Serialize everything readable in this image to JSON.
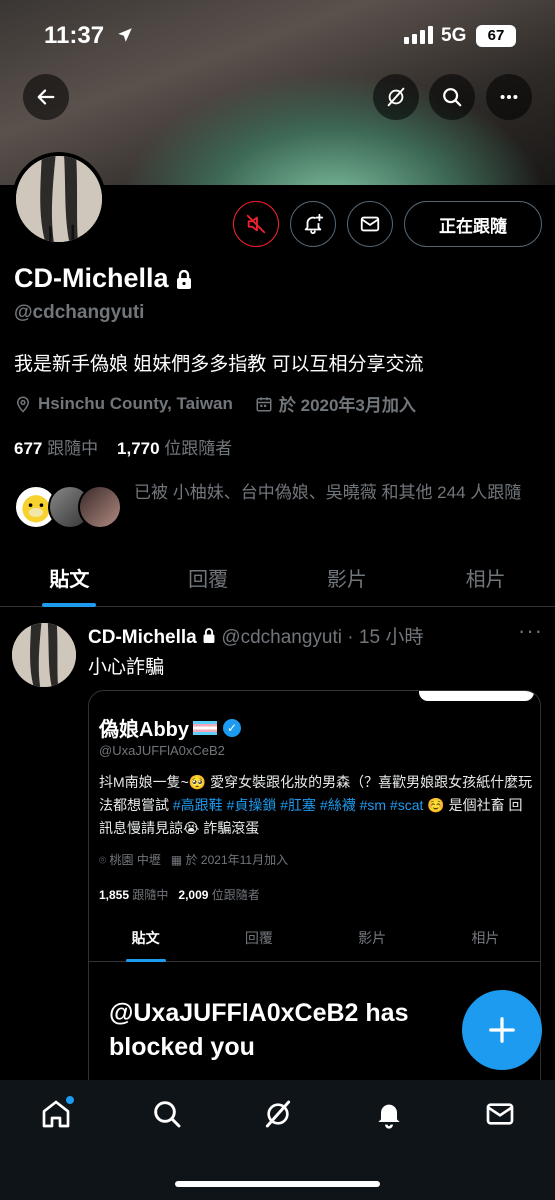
{
  "status": {
    "time": "11:37",
    "network": "5G",
    "battery": "67"
  },
  "profile": {
    "name": "CD-Michella",
    "handle": "@cdchangyuti",
    "bio": "我是新手偽娘 姐妹們多多指教 可以互相分享交流",
    "location": "Hsinchu County, Taiwan",
    "joined": "於 2020年3月加入",
    "following_count": "677",
    "following_label": "跟隨中",
    "followers_count": "1,770",
    "followers_label": "位跟隨者",
    "followed_by": "已被 小柚妹、台中偽娘、吳曉薇 和其他 244 人跟隨",
    "follow_button": "正在跟隨"
  },
  "tabs": [
    "貼文",
    "回覆",
    "影片",
    "相片"
  ],
  "post": {
    "name": "CD-Michella",
    "handle": "@cdchangyuti",
    "time": "· 15 小時",
    "text": "小心詐騙",
    "more": "···"
  },
  "embed": {
    "name": "偽娘Abby",
    "handle": "@UxaJUFFlA0xCeB2",
    "bio_a": "抖M南娘一隻~🥺 愛穿女裝跟化妝的男森（？喜歡男娘跟女孩紙什麼玩法都想嘗試 ",
    "tags": "#高跟鞋 #貞操鎖 #肛塞 #絲襪 #sm #scat",
    "bio_b": " ☺️ 是個社畜 回訊息慢請見諒😭 詐騙滾蛋",
    "location": "桃園 中壢",
    "joined": "於 2021年11月加入",
    "following_count": "1,855",
    "following_label": "跟隨中",
    "followers_count": "2,009",
    "followers_label": "位跟隨者",
    "tabs": [
      "貼文",
      "回覆",
      "影片",
      "相片"
    ],
    "blocked": "@UxaJUFFlA0xCeB2 has blocked you"
  },
  "colors": {
    "accent": "#1d9bf0",
    "mute": "#f4212e"
  }
}
